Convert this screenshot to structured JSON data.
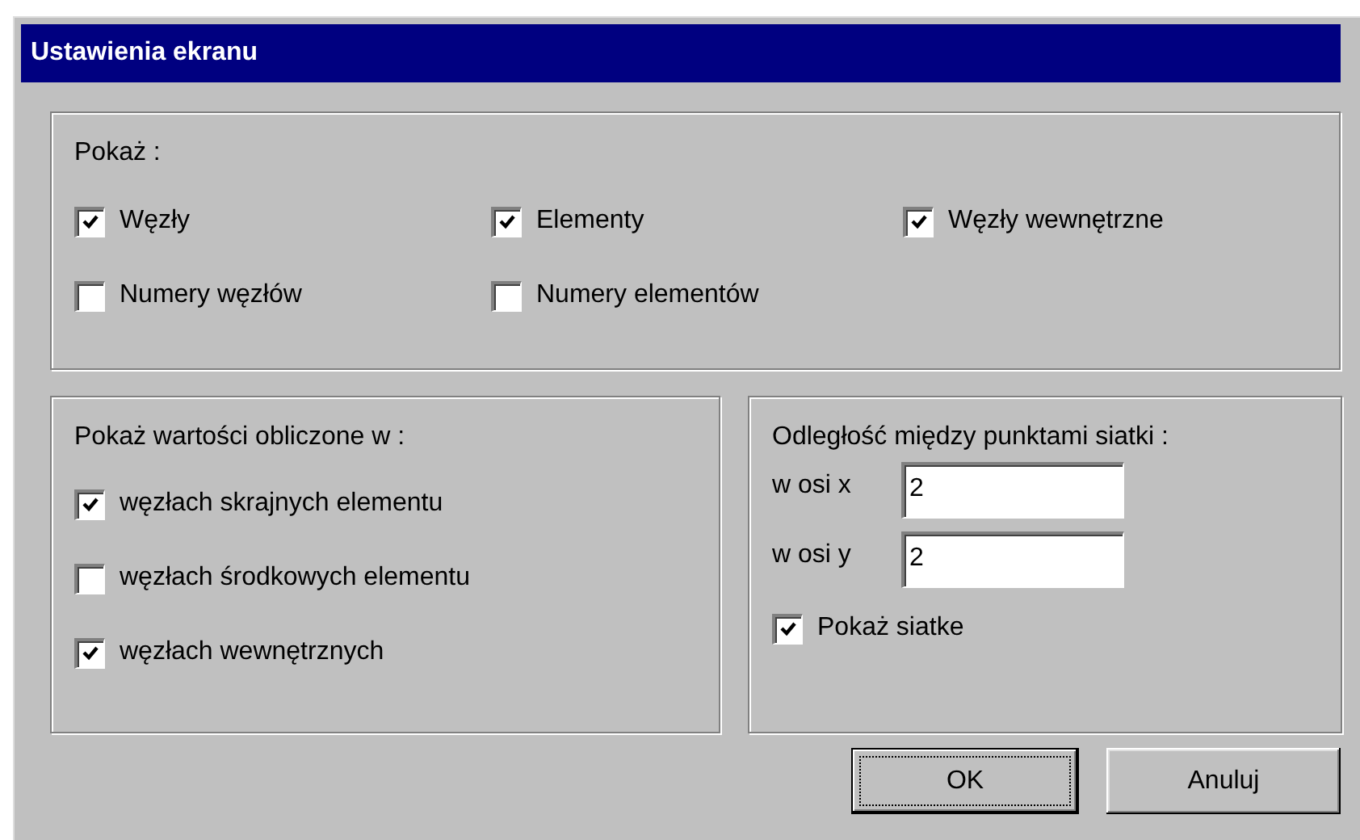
{
  "window": {
    "title": "Ustawienia ekranu"
  },
  "show_group": {
    "label": "Pokaż :",
    "checkboxes": [
      {
        "label": "Węzły",
        "checked": true
      },
      {
        "label": "Elementy",
        "checked": true
      },
      {
        "label": "Węzły wewnętrzne",
        "checked": true
      },
      {
        "label": "Numery węzłów",
        "checked": false
      },
      {
        "label": "Numery elementów",
        "checked": false
      }
    ]
  },
  "computed_group": {
    "label": "Pokaż wartości obliczone w :",
    "checkboxes": [
      {
        "label": "węzłach skrajnych elementu",
        "checked": true
      },
      {
        "label": "węzłach środkowych elementu",
        "checked": false
      },
      {
        "label": "węzłach wewnętrznych",
        "checked": true
      }
    ]
  },
  "grid_group": {
    "label": "Odległość między punktami siatki :",
    "fields": [
      {
        "label": "w osi x",
        "value": "2"
      },
      {
        "label": "w osi y",
        "value": "2"
      }
    ],
    "checkbox": {
      "label": "Pokaż siatke",
      "checked": true
    }
  },
  "buttons": [
    {
      "label": "OK",
      "default": true
    },
    {
      "label": "Anuluj",
      "default": false
    }
  ]
}
